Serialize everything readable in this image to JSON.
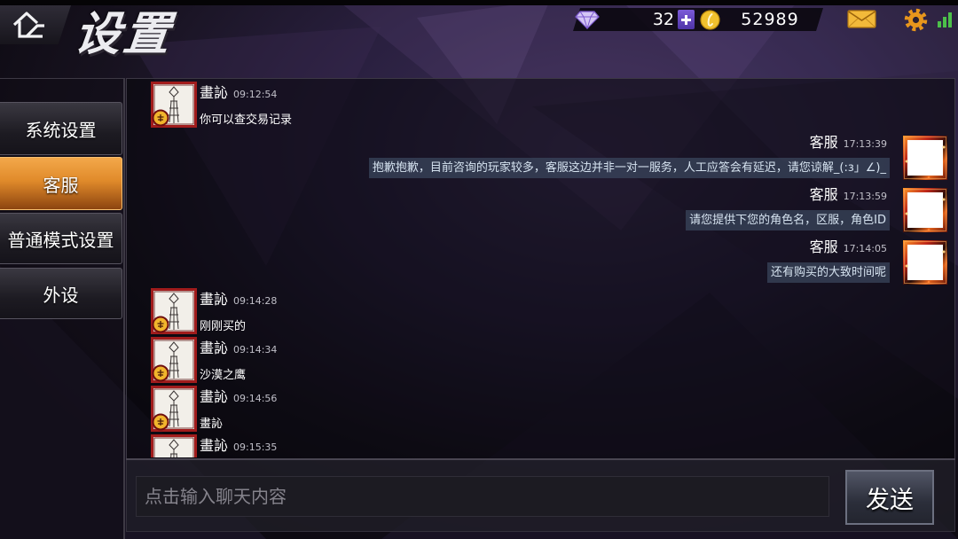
{
  "header": {
    "title": "设置",
    "diamonds": "32",
    "coins": "52989",
    "signal_bars": 3,
    "icons": {
      "back": "home-back-icon",
      "diamond": "diamond-icon",
      "add": "plus-icon",
      "coin": "coin-icon",
      "mail": "mail-icon",
      "settings": "gear-icon",
      "signal": "signal-icon"
    }
  },
  "sidebar": {
    "items": [
      {
        "label": "系统设置",
        "selected": false
      },
      {
        "label": "客服",
        "selected": true
      },
      {
        "label": "普通模式设置",
        "selected": false
      },
      {
        "label": "外设",
        "selected": false
      }
    ]
  },
  "chat": {
    "messages": [
      {
        "name": "畫訫",
        "time": "09:12:54",
        "text": "你可以查交易记录"
      },
      {
        "name": "客服",
        "time": "17:13:39",
        "text": "抱歉抱歉，目前咨询的玩家较多，客服这边并非一对一服务，人工应答会有延迟，请您谅解_(:з」∠)_"
      },
      {
        "name": "客服",
        "time": "17:13:59",
        "text": "请您提供下您的角色名，区服，角色ID"
      },
      {
        "name": "客服",
        "time": "17:14:05",
        "text": "还有购买的大致时间呢"
      },
      {
        "name": "畫訫",
        "time": "09:14:28",
        "text": "刚刚买的"
      },
      {
        "name": "畫訫",
        "time": "09:14:34",
        "text": "沙漠之鹰"
      },
      {
        "name": "畫訫",
        "time": "09:14:56",
        "text": "畫訫"
      },
      {
        "name": "畫訫",
        "time": "09:15:35"
      }
    ]
  },
  "composer": {
    "placeholder": "点击输入聊天内容",
    "send_label": "发送"
  },
  "colors": {
    "selected_tab": "#e08a2a",
    "add_button": "#7b5ad8",
    "coin": "#f2c12e",
    "mail": "#f2b93a",
    "gear": "#e8961c",
    "signal": "#4cc04a",
    "service_bubble": "#3c4860"
  }
}
